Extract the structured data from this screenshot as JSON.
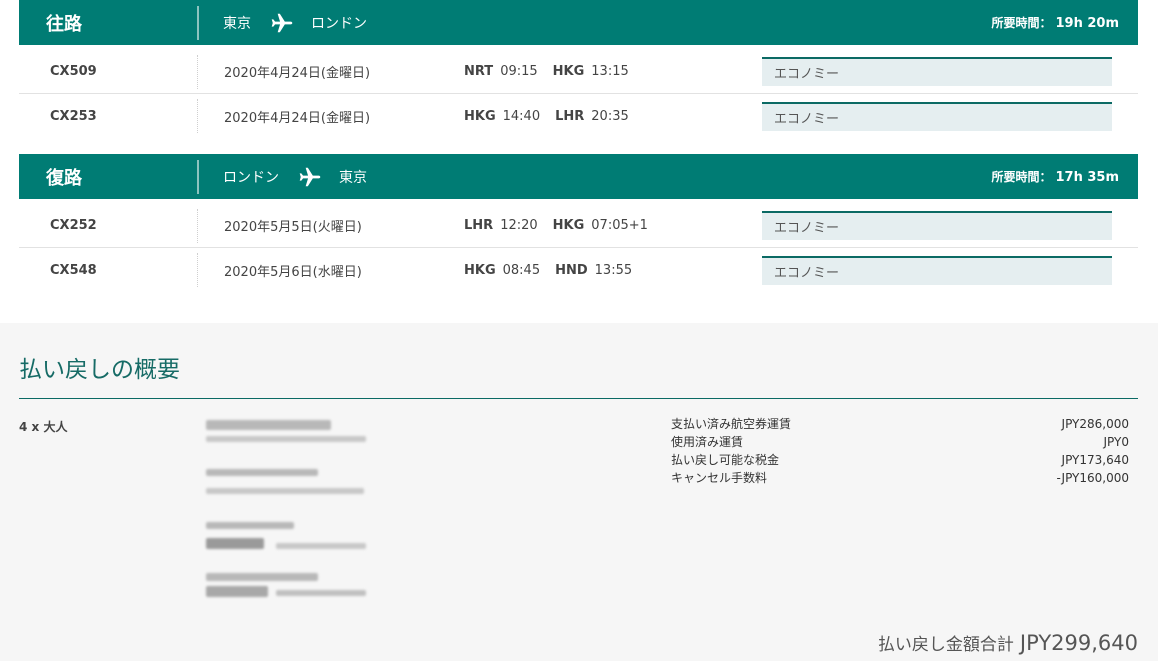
{
  "outbound": {
    "label": "往路",
    "from": "東京",
    "to": "ロンドン",
    "duration_label": "所要時間：",
    "duration": "19h 20m",
    "flights": [
      {
        "no": "CX509",
        "date": "2020年4月24日(金曜日)",
        "dep_code": "NRT",
        "dep_time": "09:15",
        "arr_code": "HKG",
        "arr_time": "13:15",
        "cabin": "エコノミー"
      },
      {
        "no": "CX253",
        "date": "2020年4月24日(金曜日)",
        "dep_code": "HKG",
        "dep_time": "14:40",
        "arr_code": "LHR",
        "arr_time": "20:35",
        "cabin": "エコノミー"
      }
    ]
  },
  "inbound": {
    "label": "復路",
    "from": "ロンドン",
    "to": "東京",
    "duration_label": "所要時間：",
    "duration": "17h 35m",
    "flights": [
      {
        "no": "CX252",
        "date": "2020年5月5日(火曜日)",
        "dep_code": "LHR",
        "dep_time": "12:20",
        "arr_code": "HKG",
        "arr_time": "07:05+1",
        "cabin": "エコノミー"
      },
      {
        "no": "CX548",
        "date": "2020年5月6日(水曜日)",
        "dep_code": "HKG",
        "dep_time": "08:45",
        "arr_code": "HND",
        "arr_time": "13:55",
        "cabin": "エコノミー"
      }
    ]
  },
  "summary": {
    "title": "払い戻しの概要",
    "passengers": "4 x 大人",
    "charges": [
      {
        "label": "支払い済み航空券運賃",
        "amount": "JPY286,000"
      },
      {
        "label": "使用済み運賃",
        "amount": "JPY0"
      },
      {
        "label": "払い戻し可能な税金",
        "amount": "JPY173,640"
      },
      {
        "label": "キャンセル手数料",
        "amount": "-JPY160,000"
      }
    ],
    "total_label": "払い戻し金額合計",
    "total_value": "JPY299,640"
  },
  "icons": {
    "plane": "airplane-icon"
  },
  "colors": {
    "brand": "#007c74",
    "cabin_bg": "#e5eef0",
    "summary_bg": "#f6f6f6"
  }
}
